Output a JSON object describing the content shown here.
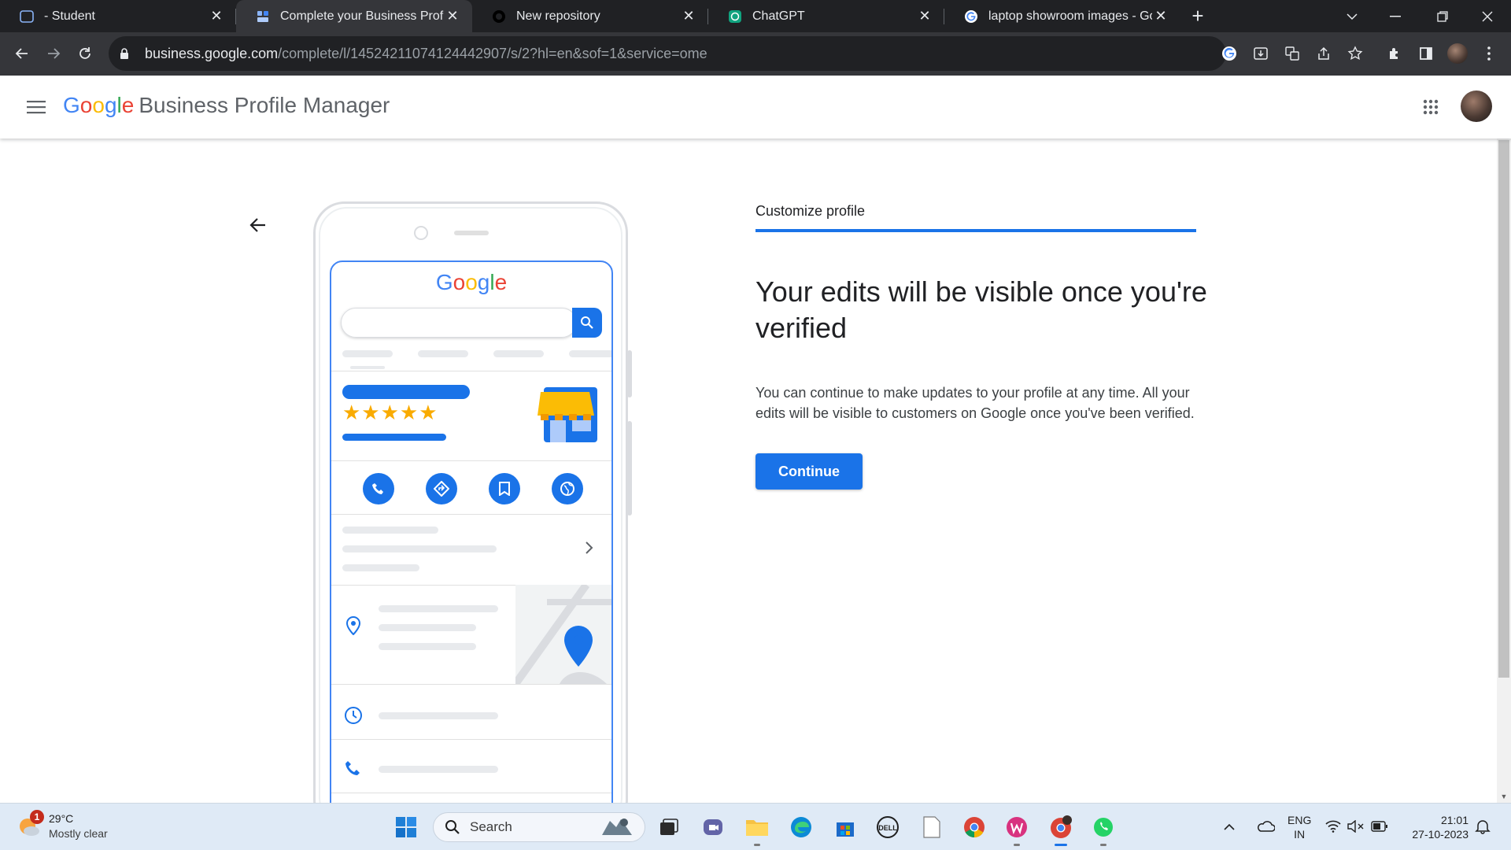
{
  "browser": {
    "tabs": [
      {
        "title": "- Student",
        "active": false
      },
      {
        "title": "Complete your Business Profile",
        "active": true
      },
      {
        "title": "New repository",
        "active": false
      },
      {
        "title": "ChatGPT",
        "active": false
      },
      {
        "title": "laptop showroom images - Goo",
        "active": false
      }
    ],
    "url_host": "business.google.com",
    "url_path": "/complete/l/14524211074124442907/s/2?hl=en&sof=1&service=ome"
  },
  "header": {
    "logo_letters": [
      "G",
      "o",
      "o",
      "g",
      "l",
      "e"
    ],
    "product_name": "Business Profile Manager"
  },
  "phone": {
    "logo_letters": [
      "G",
      "o",
      "o",
      "g",
      "l",
      "e"
    ],
    "stars": "★★★★★"
  },
  "panel": {
    "step_label": "Customize profile",
    "headline": "Your edits will be visible once you're verified",
    "body": "You can continue to make updates to your profile at any time. All your edits will be visible to customers on Google once you've been verified.",
    "continue_label": "Continue"
  },
  "taskbar": {
    "weather_badge": "1",
    "temperature": "29°C",
    "condition": "Mostly clear",
    "search_label": "Search",
    "lang_line1": "ENG",
    "lang_line2": "IN",
    "time": "21:01",
    "date": "27-10-2023"
  },
  "colors": {
    "google_blue": "#4285f4",
    "google_red": "#ea4335",
    "google_yellow": "#fbbc05",
    "google_green": "#34a853",
    "primary_button": "#1a73e8"
  }
}
